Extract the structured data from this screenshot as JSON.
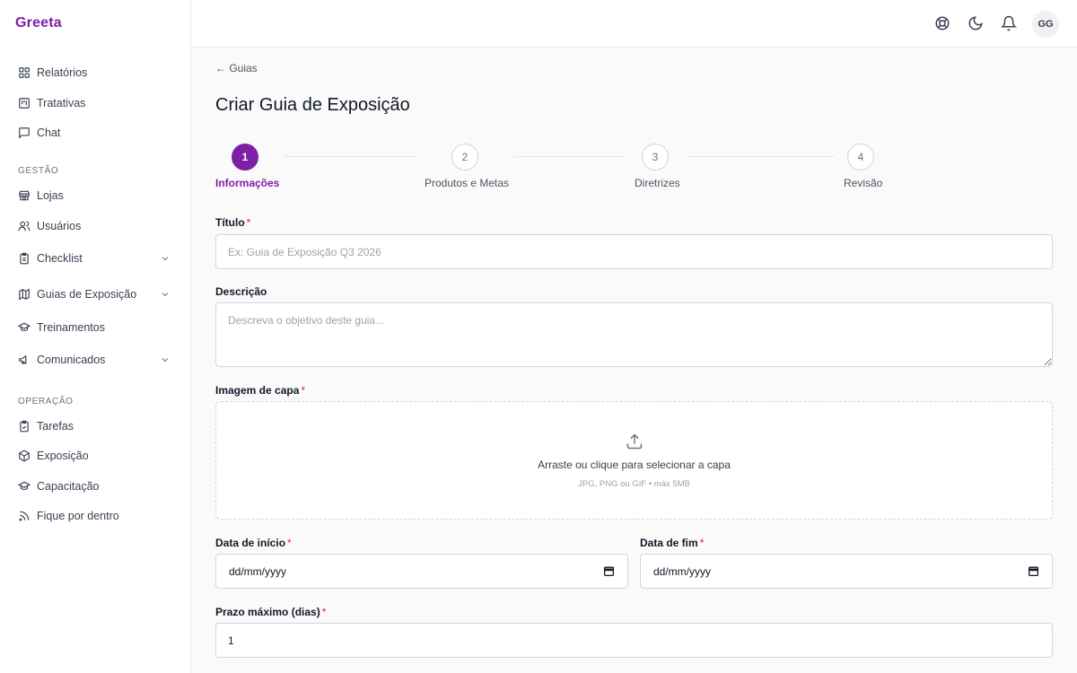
{
  "app": {
    "logo": "Greeta"
  },
  "sidebar": {
    "items_top": [
      {
        "label": "Relatórios",
        "icon": "grid-icon"
      },
      {
        "label": "Tratativas",
        "icon": "kanban-icon"
      },
      {
        "label": "Chat",
        "icon": "chat-icon"
      }
    ],
    "section_gestao": "GESTÃO",
    "items_gestao": [
      {
        "label": "Lojas",
        "icon": "store-icon"
      },
      {
        "label": "Usuários",
        "icon": "users-icon"
      },
      {
        "label": "Checklist",
        "icon": "clipboard-icon"
      },
      {
        "label": "Guias de Exposição",
        "icon": "map-icon"
      },
      {
        "label": "Treinamentos",
        "icon": "graduation-cap-icon"
      },
      {
        "label": "Comunicados",
        "icon": "megaphone-icon"
      }
    ],
    "section_operacao": "OPERAÇÃO",
    "items_operacao": [
      {
        "label": "Tarefas",
        "icon": "clipboard-check-icon"
      },
      {
        "label": "Exposição",
        "icon": "package-icon"
      },
      {
        "label": "Capacitação",
        "icon": "graduation-cap-icon"
      },
      {
        "label": "Fique por dentro",
        "icon": "rss-icon"
      }
    ]
  },
  "header": {
    "avatar_initials": "GG"
  },
  "main": {
    "back_link": "← Guias",
    "title": "Criar Guia de Exposição",
    "steps": [
      {
        "number": "1",
        "label": "Informações",
        "active": true
      },
      {
        "number": "2",
        "label": "Produtos e Metas"
      },
      {
        "number": "3",
        "label": "Diretrizes"
      },
      {
        "number": "4",
        "label": "Revisão"
      }
    ],
    "form": {
      "required_mark": "*",
      "titulo_label": "Título",
      "titulo_placeholder": "Ex: Guia de Exposição Q3 2026",
      "descricao_label": "Descrição",
      "descricao_placeholder": "Descreva o objetivo deste guia...",
      "capa_label": "Imagem de capa",
      "capa_text": "Arraste ou clique para selecionar a capa",
      "capa_hint": "JPG, PNG ou GIF • máx 5MB",
      "inicio_label": "Data de início",
      "inicio_value": "dd/mm/yyyy",
      "fim_label": "Data de fim",
      "fim_value": "dd/mm/yyyy",
      "prazo_label": "Prazo máximo (dias)",
      "prazo_value": "1"
    }
  },
  "colors": {
    "accent": "#7e1fa8",
    "required": "#dc2626"
  }
}
